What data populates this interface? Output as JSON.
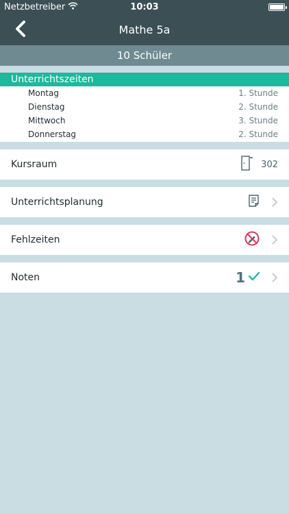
{
  "status_bar": {
    "carrier": "Netzbetreiber",
    "time": "10:03"
  },
  "nav": {
    "title": "Mathe 5a"
  },
  "students": {
    "label": "10 Schüler"
  },
  "schedule": {
    "header": "Unterrichtszeiten",
    "rows": [
      {
        "day": "Montag",
        "slot": "1. Stunde"
      },
      {
        "day": "Dienstag",
        "slot": "2. Stunde"
      },
      {
        "day": "Mittwoch",
        "slot": "3. Stunde"
      },
      {
        "day": "Donnerstag",
        "slot": "2. Stunde"
      }
    ]
  },
  "room": {
    "label": "Kursraum",
    "value": "302"
  },
  "planning": {
    "label": "Unterrichtsplanung"
  },
  "absence": {
    "label": "Fehlzeiten"
  },
  "grades": {
    "label": "Noten",
    "icon_digit": "1"
  },
  "colors": {
    "nav_bg": "#3b4f55",
    "subbar_bg": "#6f8a91",
    "accent_teal": "#20b79c",
    "page_bg": "#c9dde2",
    "absence_icon": "#d0395a"
  },
  "icons": {
    "back": "chevron-left-icon",
    "wifi": "wifi-icon",
    "battery": "battery-icon",
    "room": "door-icon",
    "planning": "notepad-icon",
    "absence": "no-pencil-icon",
    "grades": "checkmark-icon",
    "disclosure": "chevron-right-icon"
  }
}
